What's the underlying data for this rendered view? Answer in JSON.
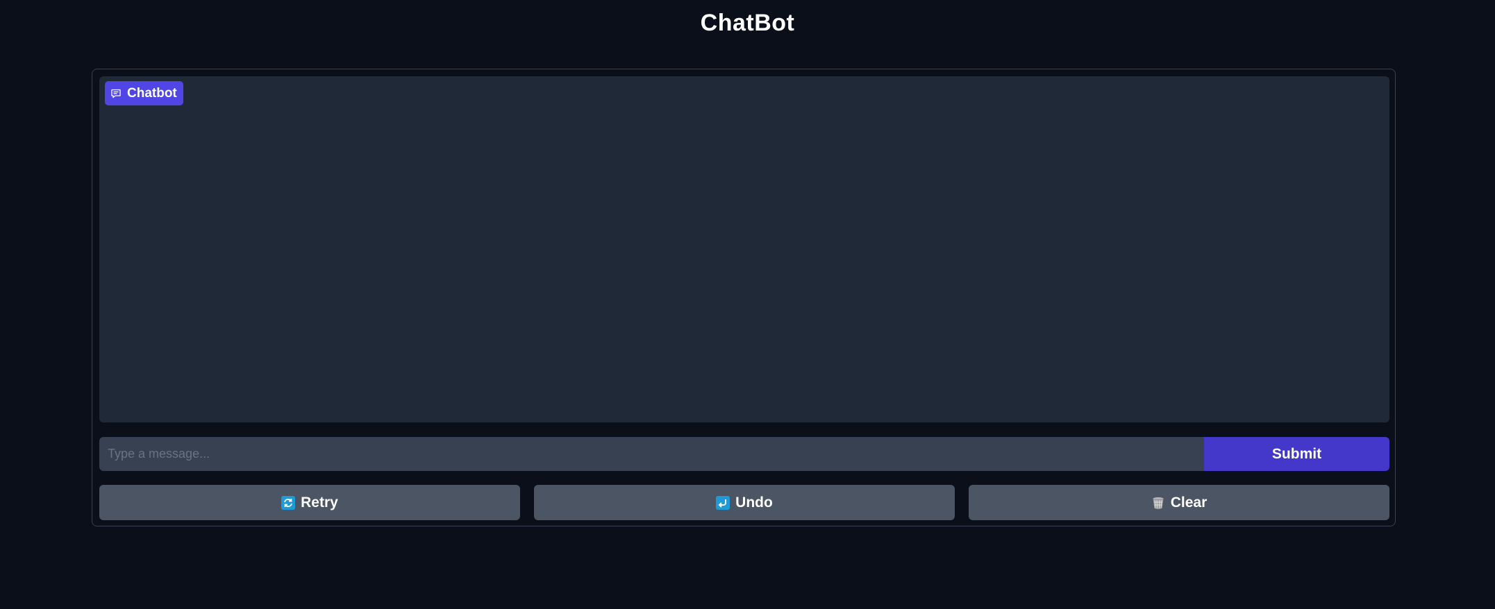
{
  "app": {
    "title": "ChatBot"
  },
  "chatbot": {
    "label": "Chatbot",
    "label_icon": "chat-bubble-icon",
    "messages": []
  },
  "composer": {
    "placeholder": "Type a message...",
    "value": "",
    "submit_label": "Submit"
  },
  "actions": [
    {
      "label": "Retry",
      "icon": "retry-icon"
    },
    {
      "label": "Undo",
      "icon": "undo-icon"
    },
    {
      "label": "Clear",
      "icon": "trash-icon"
    }
  ],
  "colors": {
    "background": "#0b0f19",
    "panel": "#1f2937",
    "accent": "#4f46e5",
    "submit": "#4338ca",
    "button": "#4b5563",
    "input": "#374151"
  }
}
